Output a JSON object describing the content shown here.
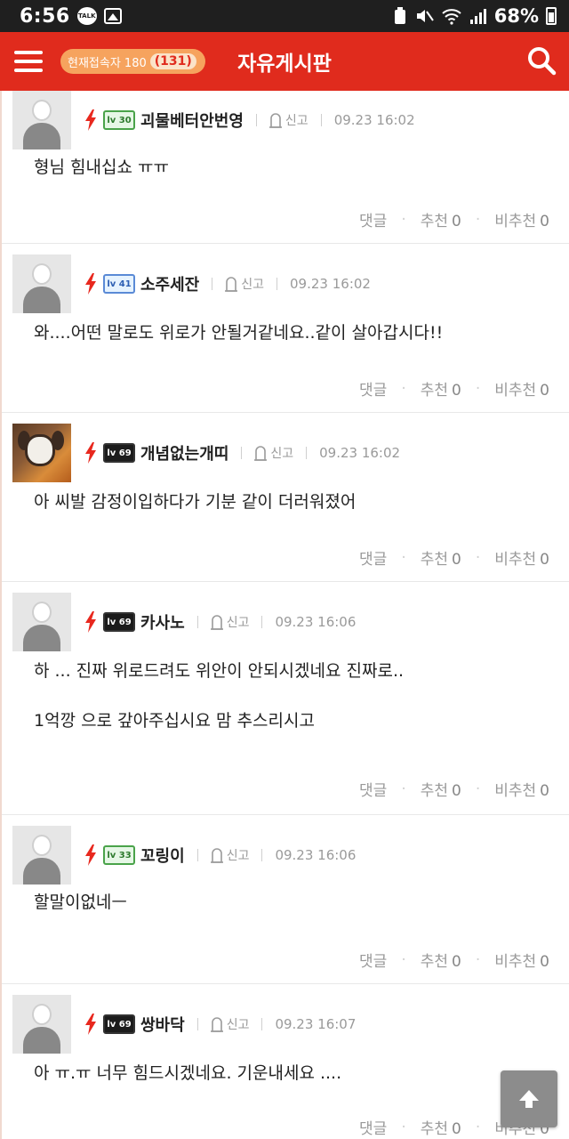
{
  "status_bar": {
    "time": "6:56",
    "talk_badge": "TALK",
    "battery": "68%"
  },
  "header": {
    "online_label": "현재접속자 180",
    "online_count": "(131)",
    "title": "자유게시판"
  },
  "report_label": "신고",
  "action_labels": {
    "reply": "댓글",
    "upvote": "추천",
    "downvote": "비추천"
  },
  "comments": [
    {
      "nickname": "괴물베터안번영",
      "level": "lv 30",
      "level_style": "green",
      "time": "09.23 16:02",
      "text": "형님 힘내십쇼 ㅠㅠ",
      "upvotes": "0",
      "downvotes": "0"
    },
    {
      "nickname": "소주세잔",
      "level": "lv 41",
      "level_style": "blue",
      "time": "09.23 16:02",
      "text": "와....어떤 말로도 위로가 안될거같네요..같이 살아갑시다!!",
      "upvotes": "0",
      "downvotes": "0"
    },
    {
      "nickname": "개념없는개띠",
      "level": "lv 69",
      "level_style": "dark",
      "time": "09.23 16:02",
      "text": "아 씨발 감정이입하다가 기분 같이 더러워졌어",
      "upvotes": "0",
      "downvotes": "0"
    },
    {
      "nickname": "카사노",
      "level": "lv 69",
      "level_style": "dark",
      "time": "09.23 16:06",
      "text": "하 ... 진짜 위로드려도 위안이 안되시겠네요 진짜로..\n\n1억깡 으로 갚아주십시요 맘 추스리시고",
      "upvotes": "0",
      "downvotes": "0"
    },
    {
      "nickname": "꼬링이",
      "level": "lv 33",
      "level_style": "green",
      "time": "09.23 16:06",
      "text": "할말이없네ㅡ",
      "upvotes": "0",
      "downvotes": "0"
    },
    {
      "nickname": "쌍바닥",
      "level": "lv 69",
      "level_style": "dark",
      "time": "09.23 16:07",
      "text": "아 ㅠ.ㅠ 너무 힘드시겠네요. 기운내세요 ....",
      "upvotes": "0",
      "downvotes": "0"
    }
  ],
  "icons": [
    "talk-icon",
    "gallery-icon",
    "menu-icon",
    "search-icon",
    "bolt-icon",
    "report-icon",
    "arrow-up-icon"
  ],
  "colors": {
    "header_red": "#e02b1d",
    "online_pill": "#f6a35e",
    "bolt_red": "#e8281e"
  }
}
